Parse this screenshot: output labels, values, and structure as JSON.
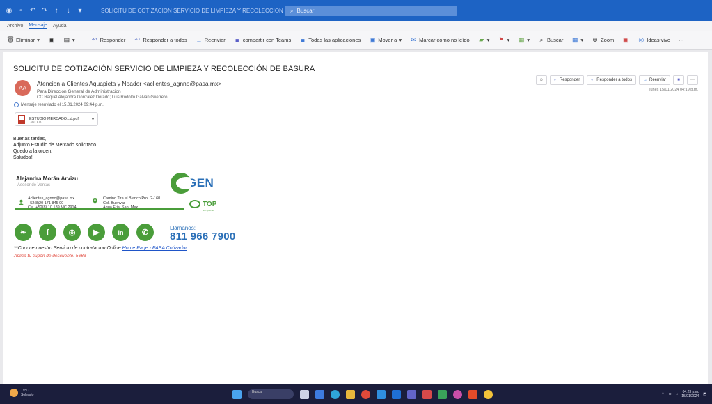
{
  "window": {
    "title": "SOLICITU DE COTIZACIÓN SERVICIO DE LIMPIEZA Y RECOLECCIÓN DE BASURA - Mensaje (HTML)",
    "search_placeholder": "Buscar"
  },
  "ribbon_tabs": [
    {
      "label": "Archivo",
      "active": false
    },
    {
      "label": "Mensaje",
      "active": true
    },
    {
      "label": "Ayuda",
      "active": false
    }
  ],
  "toolbar": {
    "delete": "Eliminar",
    "reply": "Responder",
    "reply_all": "Responder a todos",
    "forward": "Reenviar",
    "share_teams": "compartir con Teams",
    "all_apps": "Todas las aplicaciones",
    "move": "Mover a",
    "mark_read": "Marcar como no leído",
    "find": "Buscar",
    "zoom": "Zoom",
    "ideas": "Ideas vivo",
    "more": "···"
  },
  "message": {
    "subject": "SOLICITU DE COTIZACIÓN SERVICIO DE LIMPIEZA Y RECOLECCIÓN DE BASURA",
    "avatar_initials": "AA",
    "from": "Atencion a Clientes Aquapieta y Noador <aclientes_agnno@pasa.mx>",
    "to": "Para  Direccion General de Administracion",
    "cc": "CC  Raquel Alejandra Gonzalez Dorado; Luis Rodolfo Galvan Guerrero",
    "sent_note": "Mensaje reenviado el 15.01.2024 09:44 p.m.",
    "attachment": {
      "name": "ESTUDIO MERCADO...d.pdf",
      "size": "380 KB"
    },
    "actions": {
      "reply": "Responder",
      "reply_all": "Responder a todos",
      "forward": "Reenviar"
    },
    "date": "lunes 15/01/2024 04:19 p.m.",
    "body_lines": [
      "Buenas tardes,",
      "Adjunto Estudio de Mercado solicitado.",
      "Quedo a la orden.",
      "Saludos!!"
    ]
  },
  "signature": {
    "name": "Alejandra Morán Arvizu",
    "role": "Asesor de Ventas",
    "brand": "GEN",
    "contact": {
      "email": "Aclientes_agnno@pasa.mx",
      "phone1": "+52(8)20 171 845 90",
      "phone2": "Cel. +52(8) 10 189 MC 2914"
    },
    "address": {
      "line1": "Camino Tira el Blanco Prol. 2-160",
      "line2": "Col. Buenvar",
      "line3": "Agua Fria, San, Mex."
    },
    "top_logo": "TOP",
    "top_sub": "empresa",
    "social_icons": [
      "leaf-icon",
      "facebook-icon",
      "instagram-icon",
      "youtube-icon",
      "linkedin-icon",
      "whatsapp-icon"
    ],
    "call_label": "Llámanos:",
    "call_number": "811 966 7900",
    "promo_text": "**Conoce nuestro Servicio de contratacion Online ",
    "promo_link": "Home Page - PASA Cotizador",
    "coupon_text": "Aplica tu cupón de descuento: ",
    "coupon_code": "5683"
  },
  "taskbar": {
    "weather_temp": "19°C",
    "weather_desc": "Soleado",
    "search": "Buscar",
    "time": "04:23 p.m.",
    "date": "15/01/2024"
  },
  "colors": {
    "titlebar": "#1d63c4",
    "accent_green": "#4a9d3a",
    "brand_blue": "#2a6fb7",
    "coupon_red": "#e0463a",
    "taskbar": "#1b1e3c"
  }
}
